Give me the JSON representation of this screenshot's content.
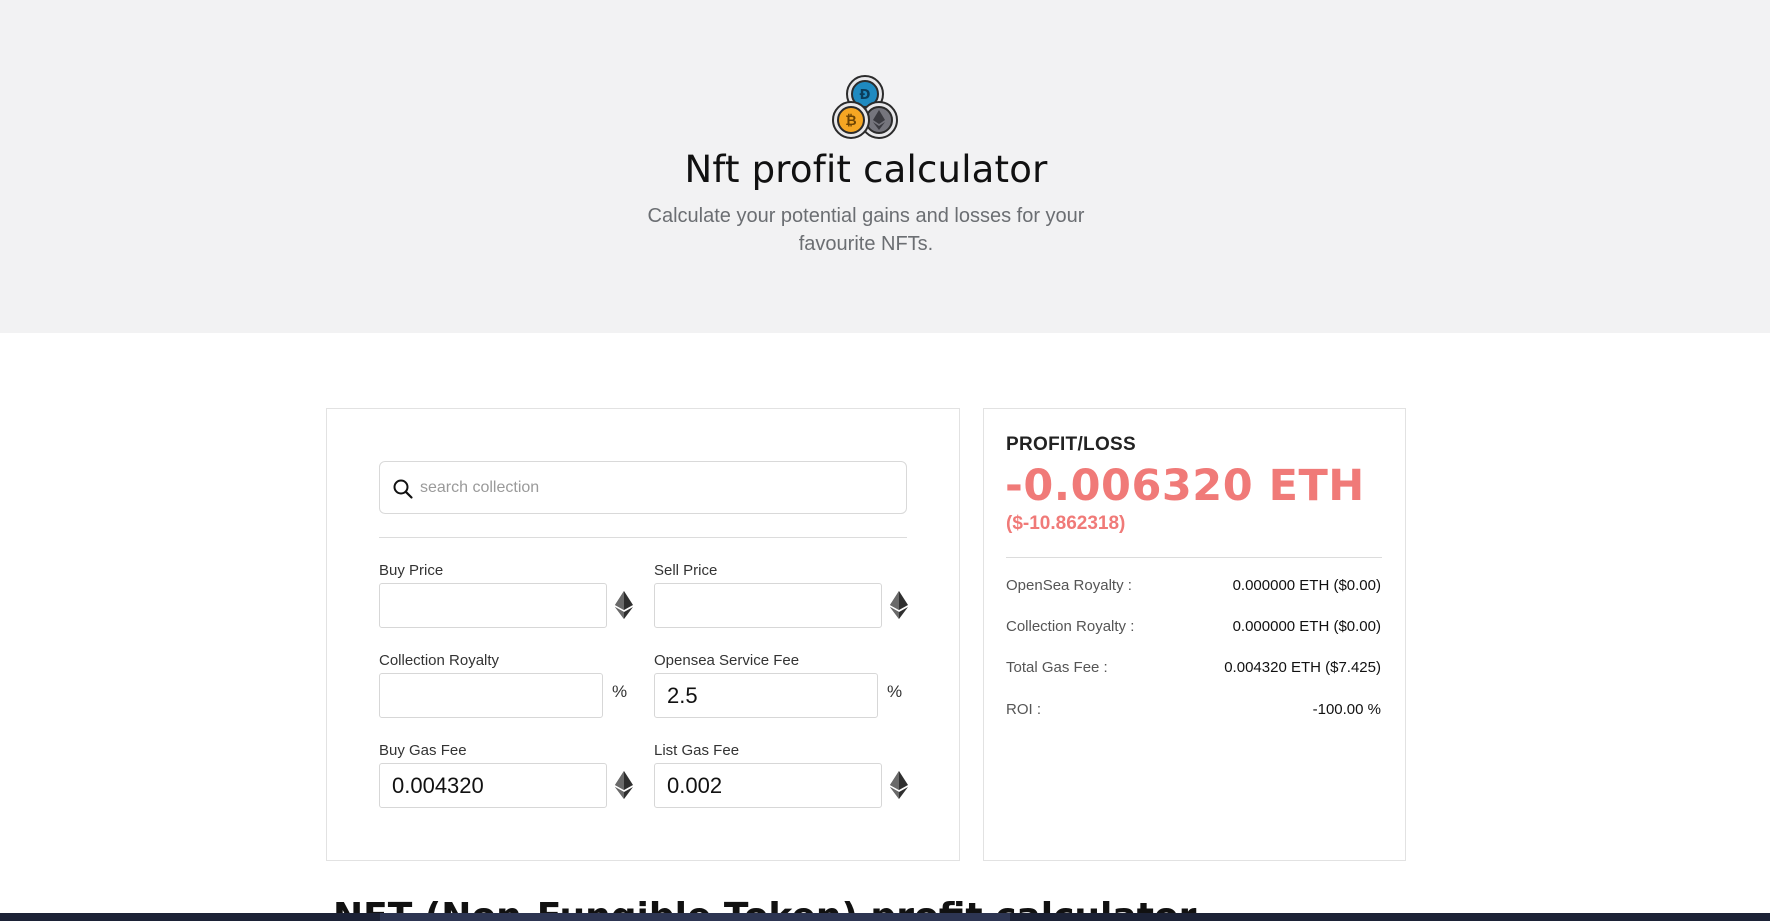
{
  "hero": {
    "title": "Nft profit calculator",
    "subtitle": "Calculate your potential gains and losses for your favourite NFTs.",
    "logo_icon": "crypto-coins-icon"
  },
  "calculator": {
    "search": {
      "placeholder": "search collection",
      "value": "",
      "icon": "search-icon"
    },
    "fields": {
      "buy_price": {
        "label": "Buy Price",
        "value": "",
        "unit_icon": "ethereum-icon"
      },
      "sell_price": {
        "label": "Sell Price",
        "value": "",
        "unit_icon": "ethereum-icon"
      },
      "collection_royalty": {
        "label": "Collection Royalty",
        "value": "",
        "unit": "%"
      },
      "opensea_service_fee": {
        "label": "Opensea Service Fee",
        "value": "2.5",
        "unit": "%"
      },
      "buy_gas_fee": {
        "label": "Buy Gas Fee",
        "value": "0.004320",
        "unit_icon": "ethereum-icon"
      },
      "list_gas_fee": {
        "label": "List Gas Fee",
        "value": "0.002",
        "unit_icon": "ethereum-icon"
      }
    }
  },
  "results": {
    "label": "PROFIT/LOSS",
    "eth": "-0.006320 ETH",
    "usd": "($-10.862318)",
    "loss_color": "#f07a78",
    "rows": [
      {
        "label": "OpenSea Royalty :",
        "value": "0.000000 ETH ($0.00)"
      },
      {
        "label": "Collection Royalty :",
        "value": "0.000000 ETH ($0.00)"
      },
      {
        "label": "Total Gas Fee :",
        "value": "0.004320 ETH ($7.425)"
      },
      {
        "label": "ROI :",
        "value": "-100.00 %"
      }
    ]
  },
  "section": {
    "heading": "NFT (Non-Fungible Token) profit calculator"
  }
}
